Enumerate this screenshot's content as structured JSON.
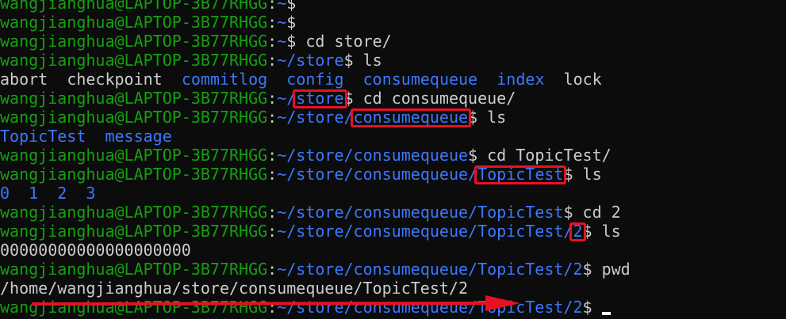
{
  "terminal": {
    "lines": [
      {
        "type": "prompt",
        "user": "wangjianghua@LAPTOP-3B77RHGG",
        "path": "~",
        "cmd": ""
      },
      {
        "type": "prompt",
        "user": "wangjianghua@LAPTOP-3B77RHGG",
        "path": "~",
        "cmd": ""
      },
      {
        "type": "prompt",
        "user": "wangjianghua@LAPTOP-3B77RHGG",
        "path": "~",
        "cmd": " cd store/"
      },
      {
        "type": "prompt",
        "user": "wangjianghua@LAPTOP-3B77RHGG",
        "path": "~/store",
        "cmd": " ls"
      },
      {
        "type": "listing",
        "items": [
          {
            "name": "abort",
            "kind": "file"
          },
          {
            "name": "checkpoint",
            "kind": "file"
          },
          {
            "name": "commitlog",
            "kind": "dir"
          },
          {
            "name": "config",
            "kind": "dir"
          },
          {
            "name": "consumequeue",
            "kind": "dir"
          },
          {
            "name": "index",
            "kind": "dir"
          },
          {
            "name": "lock",
            "kind": "file"
          }
        ]
      },
      {
        "type": "prompt",
        "user": "wangjianghua@LAPTOP-3B77RHGG",
        "path": "~/store",
        "path_pre": "~/",
        "path_hl": "store",
        "cmd": " cd consumequeue/"
      },
      {
        "type": "prompt",
        "user": "wangjianghua@LAPTOP-3B77RHGG",
        "path": "~/store/consumequeue",
        "path_pre": "~/store/",
        "path_hl": "consumequeue",
        "cmd": " ls"
      },
      {
        "type": "listing",
        "items": [
          {
            "name": "TopicTest",
            "kind": "dir"
          },
          {
            "name": "message",
            "kind": "dir"
          }
        ]
      },
      {
        "type": "prompt",
        "user": "wangjianghua@LAPTOP-3B77RHGG",
        "path": "~/store/consumequeue",
        "cmd": " cd TopicTest/"
      },
      {
        "type": "prompt",
        "user": "wangjianghua@LAPTOP-3B77RHGG",
        "path": "~/store/consumequeue/TopicTest",
        "path_pre": "~/store/consumequeue/",
        "path_hl": "TopicTest",
        "cmd": " ls"
      },
      {
        "type": "listing",
        "items": [
          {
            "name": "0",
            "kind": "dir"
          },
          {
            "name": "1",
            "kind": "dir"
          },
          {
            "name": "2",
            "kind": "dir"
          },
          {
            "name": "3",
            "kind": "dir"
          }
        ]
      },
      {
        "type": "prompt",
        "user": "wangjianghua@LAPTOP-3B77RHGG",
        "path": "~/store/consumequeue/TopicTest",
        "cmd": " cd 2"
      },
      {
        "type": "prompt",
        "user": "wangjianghua@LAPTOP-3B77RHGG",
        "path": "~/store/consumequeue/TopicTest/2",
        "path_pre": "~/store/consumequeue/TopicTest/",
        "path_hl": "2",
        "cmd": " ls"
      },
      {
        "type": "listing",
        "items": [
          {
            "name": "00000000000000000000",
            "kind": "file"
          }
        ]
      },
      {
        "type": "prompt",
        "user": "wangjianghua@LAPTOP-3B77RHGG",
        "path": "~/store/consumequeue/TopicTest/2",
        "cmd": " pwd"
      },
      {
        "type": "output",
        "text": "/home/wangjianghua/store/consumequeue/TopicTest/2"
      },
      {
        "type": "prompt",
        "user": "wangjianghua@LAPTOP-3B77RHGG",
        "path": "~/store/consumequeue/TopicTest/2",
        "cmd": " ",
        "cursor": true
      }
    ]
  },
  "colors": {
    "background": "#0c0c0c",
    "user": "#13a10e",
    "path": "#3b78ff",
    "text": "#cccccc",
    "annotation": "#e81123"
  }
}
